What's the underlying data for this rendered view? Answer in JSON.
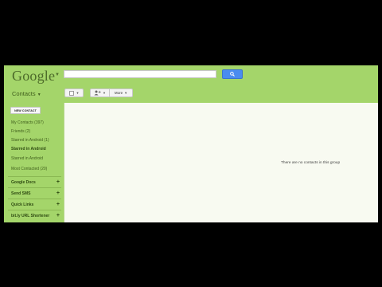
{
  "header": {
    "logo": "Google",
    "search": {
      "value": "",
      "placeholder": ""
    }
  },
  "toolbar": {
    "more_label": "More"
  },
  "sidebar": {
    "title": "Contacts",
    "new_contact_label": "NEW CONTACT",
    "items": [
      {
        "label": "My Contacts (397)"
      },
      {
        "label": "Friends (2)"
      },
      {
        "label": "Starred in Android (1)"
      },
      {
        "label": "Starred in Android"
      },
      {
        "label": "Starred in Android"
      },
      {
        "label": "Most Contacted (20)"
      }
    ],
    "gadgets": [
      {
        "label": "Google Docs"
      },
      {
        "label": "Send SMS"
      },
      {
        "label": "Quick Links"
      },
      {
        "label": "bit.ly URL Shortener"
      }
    ]
  },
  "main": {
    "empty_message": "There are no contacts in this group"
  },
  "colors": {
    "theme_green": "#a4d56a",
    "panel_bg": "#f8faf1",
    "search_button": "#4a8cf0"
  }
}
